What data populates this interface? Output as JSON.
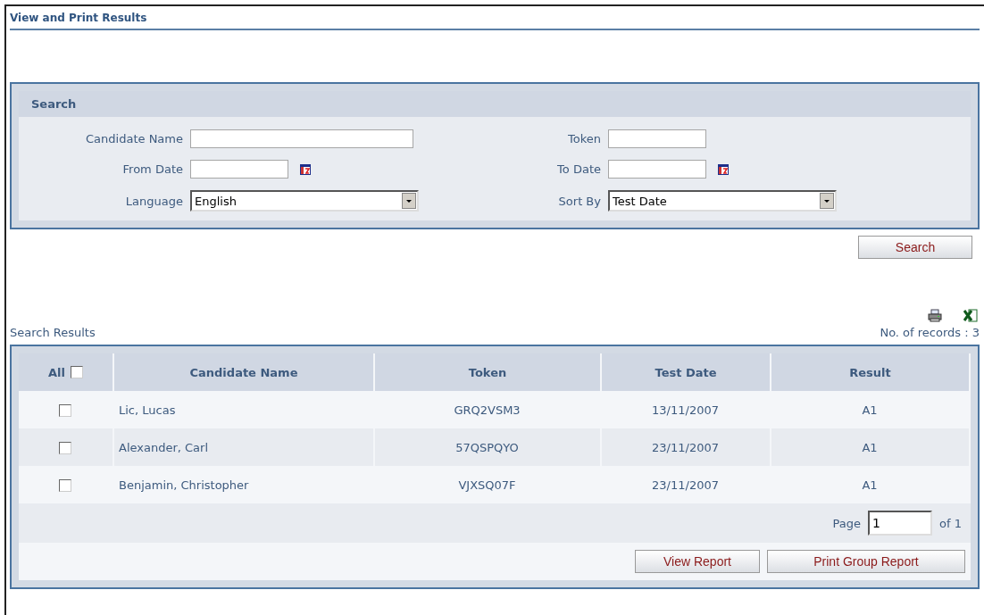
{
  "page_title": "View and Print Results",
  "search": {
    "title": "Search",
    "fields": [
      {
        "label": "Candidate Name",
        "kind": "text"
      },
      {
        "label": "Token",
        "kind": "text"
      },
      {
        "label": "From Date",
        "kind": "date"
      },
      {
        "label": "To Date",
        "kind": "date"
      },
      {
        "label": "Language",
        "kind": "select",
        "value": "English"
      },
      {
        "label": "Sort By",
        "kind": "select",
        "value": "Test Date"
      }
    ],
    "button": "Search"
  },
  "results": {
    "title": "Search Results",
    "record_count": "No. of records : 3",
    "all_label": "All",
    "all_checked": false,
    "columns": [
      "Candidate Name",
      "Token",
      "Test Date",
      "Result"
    ],
    "rows": [
      {
        "checked": false,
        "cells": [
          "Lic, Lucas",
          "GRQ2VSM3",
          "13/11/2007",
          "A1"
        ]
      },
      {
        "checked": false,
        "cells": [
          "Alexander, Carl",
          "57QSPQYO",
          "23/11/2007",
          "A1"
        ]
      },
      {
        "checked": false,
        "cells": [
          "Benjamin, Christopher",
          "VJXSQ07F",
          "23/11/2007",
          "A1"
        ]
      }
    ],
    "page_label": "Page",
    "page_value": "1",
    "page_total": "of 1",
    "buttons": [
      "View Report",
      "Print Group Report"
    ]
  }
}
